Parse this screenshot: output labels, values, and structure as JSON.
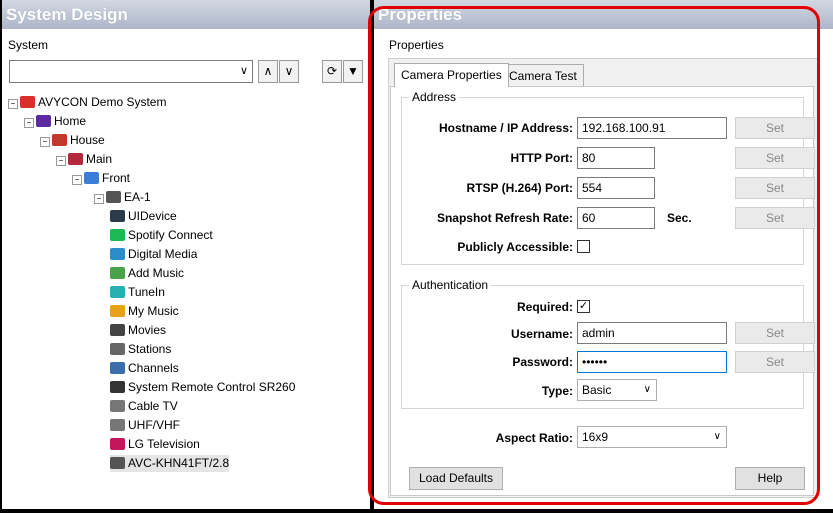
{
  "left": {
    "title": "System Design",
    "label": "System",
    "tree": [
      {
        "label": "AVYCON Demo System",
        "icon": "avycon-logo-icon",
        "color": "#d9302c",
        "exp": "−"
      },
      {
        "label": "Home",
        "icon": "home-heart-icon",
        "color": "#5b2aa0",
        "exp": "−"
      },
      {
        "label": "House",
        "icon": "house-icon",
        "color": "#c0392b",
        "exp": "−"
      },
      {
        "label": "Main",
        "icon": "floor-icon",
        "color": "#b3283b",
        "exp": "−"
      },
      {
        "label": "Front",
        "icon": "room-icon",
        "color": "#3b7dd8",
        "exp": "−"
      },
      {
        "label": "EA-1",
        "icon": "device-box-icon",
        "color": "#555555",
        "exp": "−"
      },
      {
        "label": "UIDevice",
        "icon": "ui-device-icon",
        "color": "#2b3a4a",
        "exp": ""
      },
      {
        "label": "Spotify Connect",
        "icon": "spotify-icon",
        "color": "#1db954",
        "exp": ""
      },
      {
        "label": "Digital Media",
        "icon": "digital-media-icon",
        "color": "#2c8ec9",
        "exp": ""
      },
      {
        "label": "Add Music",
        "icon": "add-music-icon",
        "color": "#4aa24a",
        "exp": ""
      },
      {
        "label": "TuneIn",
        "icon": "tunein-icon",
        "color": "#2ab0b0",
        "exp": ""
      },
      {
        "label": "My Music",
        "icon": "my-music-icon",
        "color": "#e7a11b",
        "exp": ""
      },
      {
        "label": "Movies",
        "icon": "movies-icon",
        "color": "#444444",
        "exp": ""
      },
      {
        "label": "Stations",
        "icon": "stations-icon",
        "color": "#666666",
        "exp": ""
      },
      {
        "label": "Channels",
        "icon": "channels-icon",
        "color": "#3a6ea8",
        "exp": ""
      },
      {
        "label": "System Remote Control SR260",
        "icon": "remote-icon",
        "color": "#333333",
        "exp": ""
      },
      {
        "label": "Cable TV",
        "icon": "cable-icon",
        "color": "#777777",
        "exp": ""
      },
      {
        "label": "UHF/VHF",
        "icon": "antenna-icon",
        "color": "#777777",
        "exp": ""
      },
      {
        "label": "LG Television",
        "icon": "lg-icon",
        "color": "#c2185b",
        "exp": ""
      },
      {
        "label": "AVC-KHN41FT/2.8",
        "icon": "camera-icon",
        "color": "#555555",
        "exp": ""
      }
    ]
  },
  "right": {
    "title": "Properties",
    "label": "Properties",
    "tabs": [
      "Camera Properties",
      "Camera Test"
    ],
    "address": {
      "title": "Address",
      "hostname_label": "Hostname / IP Address:",
      "hostname": "192.168.100.91",
      "http_label": "HTTP Port:",
      "http": "80",
      "rtsp_label": "RTSP (H.264) Port:",
      "rtsp": "554",
      "snapshot_label": "Snapshot Refresh Rate:",
      "snapshot": "60",
      "snapshot_unit": "Sec.",
      "public_label": "Publicly Accessible:",
      "set": "Set"
    },
    "auth": {
      "title": "Authentication",
      "required_label": "Required:",
      "required_mark": "✓",
      "username_label": "Username:",
      "username": "admin",
      "password_label": "Password:",
      "password": "••••••",
      "type_label": "Type:",
      "type": "Basic"
    },
    "aspect_label": "Aspect Ratio:",
    "aspect": "16x9",
    "load_defaults": "Load Defaults",
    "help": "Help"
  }
}
